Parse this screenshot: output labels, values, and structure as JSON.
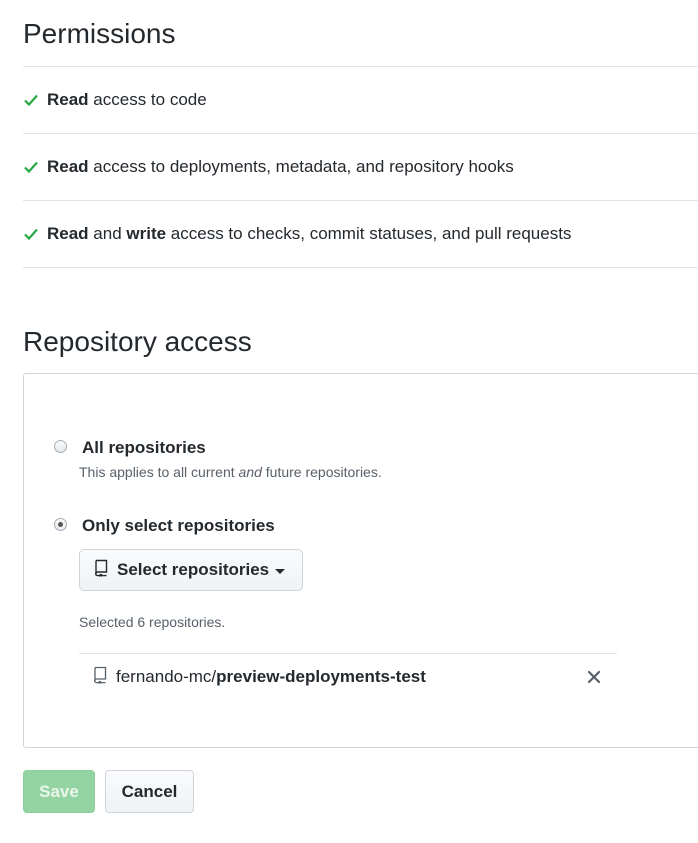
{
  "permissions": {
    "title": "Permissions",
    "items": [
      {
        "parts": [
          {
            "text": "Read",
            "bold": true
          },
          {
            "text": " access to code",
            "bold": false
          }
        ]
      },
      {
        "parts": [
          {
            "text": "Read",
            "bold": true
          },
          {
            "text": " access to deployments, metadata, and repository hooks",
            "bold": false
          }
        ]
      },
      {
        "parts": [
          {
            "text": "Read",
            "bold": true
          },
          {
            "text": " and ",
            "bold": false
          },
          {
            "text": "write",
            "bold": true
          },
          {
            "text": " access to checks, commit statuses, and pull requests",
            "bold": false
          }
        ]
      }
    ]
  },
  "repository_access": {
    "title": "Repository access",
    "all_repositories": {
      "label": "All repositories",
      "note_before": "This applies to all current ",
      "note_em": "and",
      "note_after": " future repositories.",
      "checked": false
    },
    "only_select": {
      "label": "Only select repositories",
      "checked": true
    },
    "select_button_label": "Select repositories",
    "selected_count_text": "Selected 6 repositories.",
    "repos": [
      {
        "owner": "fernando-mc/",
        "name": "preview-deployments-test"
      }
    ]
  },
  "actions": {
    "save_label": "Save",
    "cancel_label": "Cancel"
  },
  "colors": {
    "check_green": "#28a745",
    "save_green_disabled": "#94d3a2"
  }
}
